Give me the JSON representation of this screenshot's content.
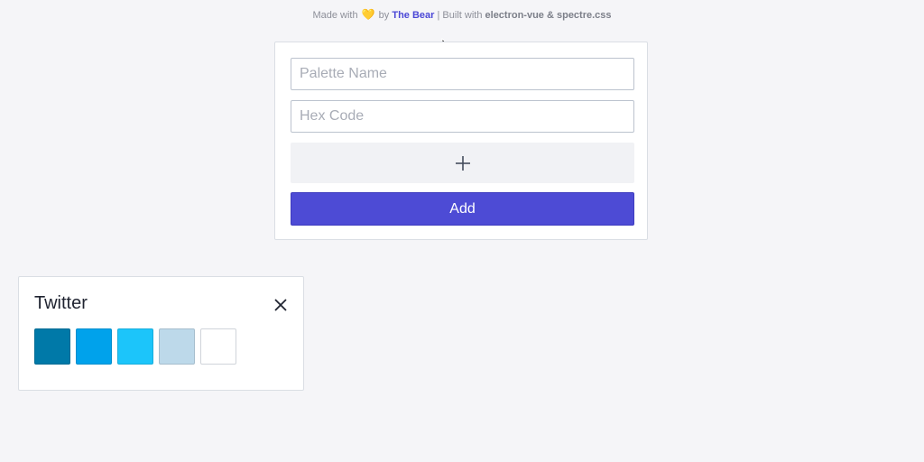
{
  "credits": {
    "made_with": "Made with",
    "by": "by",
    "author": "The Bear",
    "separator": "|",
    "built_with": "Built with",
    "tech": "electron-vue & spectre.css"
  },
  "form": {
    "name_placeholder": "Palette Name",
    "name_value": "",
    "hex_placeholder": "Hex Code",
    "hex_value": "",
    "add_label": "Add"
  },
  "palette": {
    "title": "Twitter",
    "swatches": [
      "#0079a8",
      "#00a2eb",
      "#1cc5fa",
      "#bdd9ea",
      "#ffffff"
    ]
  },
  "colors": {
    "accent": "#4d4bd5",
    "background": "#f5f5f8",
    "heart": "#f2c530"
  },
  "icons": {
    "heart": "heart-icon",
    "plus": "plus-icon",
    "close": "close-icon",
    "cursor": "cursor-icon"
  }
}
